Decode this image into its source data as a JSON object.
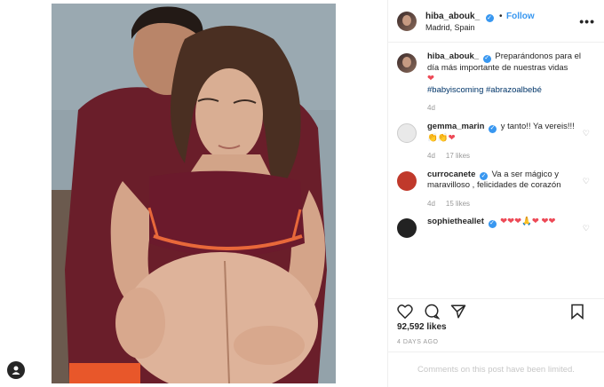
{
  "post": {
    "photo_description_icon": "photo",
    "corner_icon": "user-icon"
  },
  "header": {
    "username": "hiba_abouk_",
    "separator": "•",
    "follow_label": "Follow",
    "location": "Madrid, Spain",
    "more_label": "•••"
  },
  "caption": {
    "username": "hiba_abouk_",
    "text": "Preparándonos para el día más importante de nuestras vidas",
    "hashtag1": "#babyiscoming",
    "hashtag2": "#abrazoalbebé",
    "time": "4d"
  },
  "comments": [
    {
      "username": "gemma_marin",
      "text": "y tanto!! Ya vereis!!!",
      "time": "4d",
      "likes": "17 likes"
    },
    {
      "username": "currocanete",
      "text": "Va a ser mágico y maravilloso , felicidades de corazón",
      "time": "4d",
      "likes": "15 likes"
    },
    {
      "username": "sophietheallet",
      "text": ""
    }
  ],
  "stats": {
    "likes": "92,592 likes",
    "ago": "4 DAYS AGO"
  },
  "footer": {
    "limited": "Comments on this post have been limited."
  },
  "colors": {
    "accent": "#3897f0",
    "heart": "#ed4956",
    "muted": "#999999"
  }
}
